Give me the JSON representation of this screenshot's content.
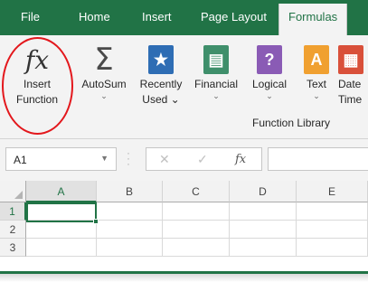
{
  "tabs": [
    {
      "label": "File",
      "active": false
    },
    {
      "label": "Home",
      "active": false
    },
    {
      "label": "Insert",
      "active": false
    },
    {
      "label": "Page Layout",
      "active": false
    },
    {
      "label": "Formulas",
      "active": true
    }
  ],
  "ribbon": {
    "insert_function": {
      "icon": "fx",
      "line1": "Insert",
      "line2": "Function"
    },
    "autosum": {
      "icon": "Σ",
      "label": "AutoSum"
    },
    "recently_used": {
      "icon": "★",
      "line1": "Recently",
      "line2": "Used"
    },
    "financial": {
      "icon": "▤",
      "label": "Financial"
    },
    "logical": {
      "icon": "?",
      "label": "Logical"
    },
    "text": {
      "icon": "A",
      "label": "Text"
    },
    "date_time": {
      "icon": "▦",
      "line1": "Date",
      "line2": "Time"
    },
    "group_label": "Function Library",
    "highlight_color": "#e3171c"
  },
  "formula_bar": {
    "name_box": "A1",
    "cancel_icon": "✕",
    "enter_icon": "✓",
    "fx_icon": "fx",
    "value": ""
  },
  "grid": {
    "columns": [
      "A",
      "B",
      "C",
      "D",
      "E"
    ],
    "rows": [
      "1",
      "2",
      "3"
    ],
    "selected_cell": "A1"
  },
  "colors": {
    "accent": "#217346",
    "recently_used": "#2e6db4",
    "financial": "#3f8f6b",
    "logical": "#8a5bb5",
    "text": "#f0a030",
    "date_time": "#d9503a"
  }
}
